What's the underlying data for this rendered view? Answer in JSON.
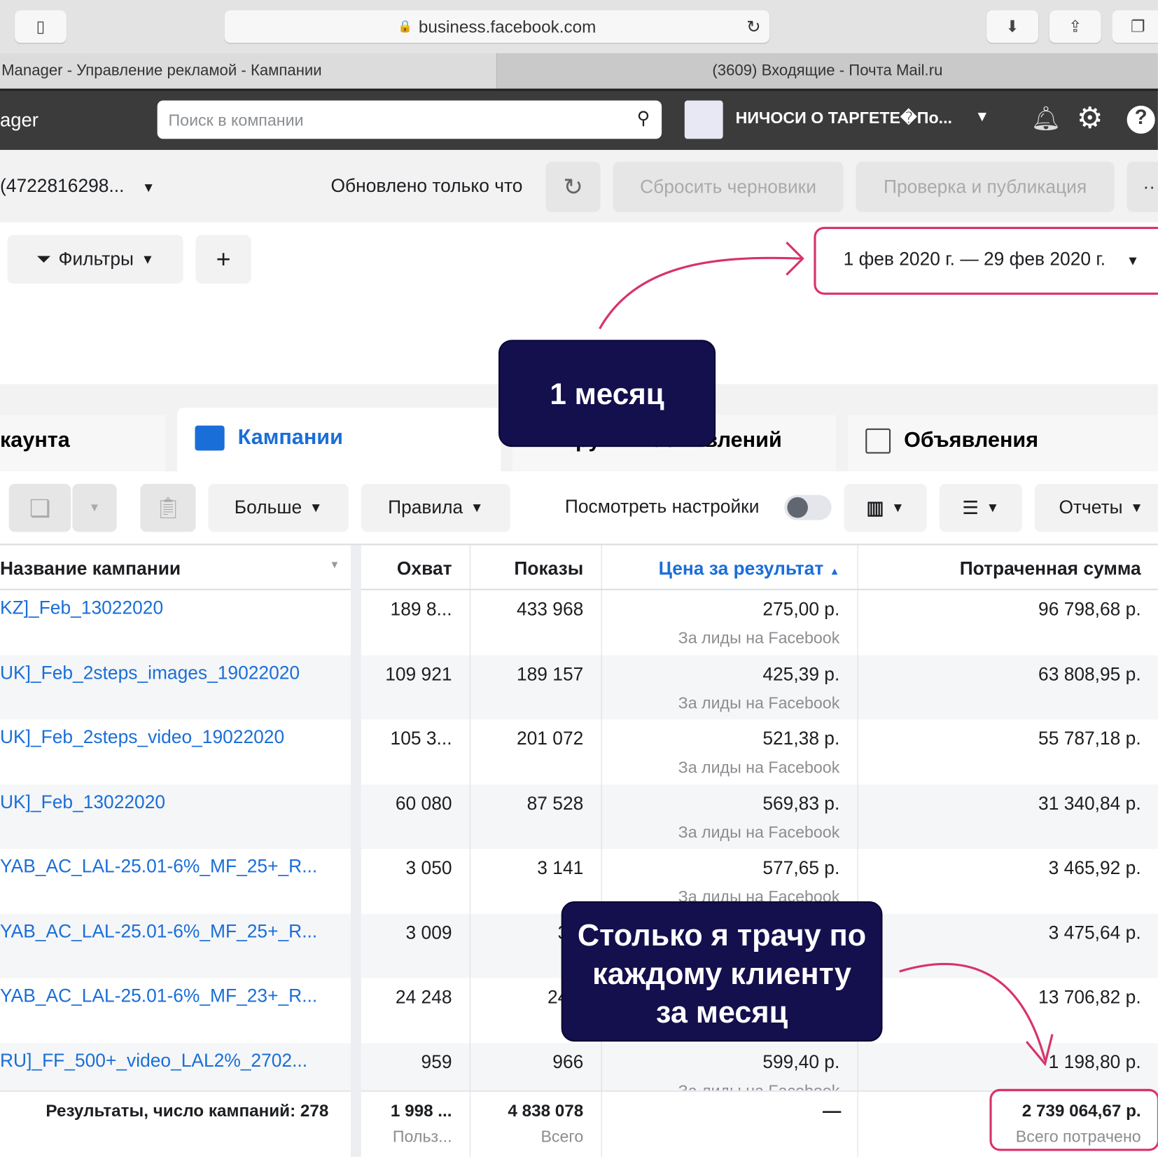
{
  "browser": {
    "url": "business.facebook.com",
    "tabs": [
      "Manager - Управление рекламой - Кампании",
      "(3609) Входящие - Почта Mail.ru"
    ]
  },
  "topbar": {
    "app_title": "ager",
    "search_placeholder": "Поиск в компании",
    "account_name": "НИЧОСИ О ТАРГЕТЕ�По..."
  },
  "toolbar": {
    "account_id": "(4722816298...",
    "updated": "Обновлено только что",
    "reset_drafts": "Сбросить черновики",
    "review_publish": "Проверка и публикация",
    "more": "··"
  },
  "filters": {
    "label": "Фильтры",
    "add": "+",
    "date_range": "1 фев 2020 г. — 29 фев 2020 г."
  },
  "level_tabs": {
    "account": "каунта",
    "campaigns": "Кампании",
    "adsets": "Группы объявлений",
    "ads": "Объявления"
  },
  "actions": {
    "more": "Больше",
    "rules": "Правила",
    "view_settings": "Посмотреть настройки",
    "reports": "Отчеты",
    "view_settings_on": false
  },
  "table": {
    "headers": {
      "name": "Название кампании",
      "reach": "Охват",
      "impressions": "Показы",
      "cost": "Цена за результат",
      "spent": "Потраченная сумма"
    },
    "rows": [
      {
        "name": "KZ]_Feb_13022020",
        "reach": "189 8...",
        "impressions": "433 968",
        "cost": "275,00 р.",
        "cost_sub": "За лиды на Facebook",
        "spent": "96 798,68 р."
      },
      {
        "name": "UK]_Feb_2steps_images_19022020",
        "reach": "109 921",
        "impressions": "189 157",
        "cost": "425,39 р.",
        "cost_sub": "За лиды на Facebook",
        "spent": "63 808,95 р."
      },
      {
        "name": "UK]_Feb_2steps_video_19022020",
        "reach": "105 3...",
        "impressions": "201 072",
        "cost": "521,38 р.",
        "cost_sub": "За лиды на Facebook",
        "spent": "55 787,18 р."
      },
      {
        "name": "UK]_Feb_13022020",
        "reach": "60 080",
        "impressions": "87 528",
        "cost": "569,83 р.",
        "cost_sub": "За лиды на Facebook",
        "spent": "31 340,84 р."
      },
      {
        "name": "YAB_AC_LAL-25.01-6%_MF_25+_R...",
        "reach": "3 050",
        "impressions": "3 141",
        "cost": "577,65 р.",
        "cost_sub": "За лиды на Facebook",
        "spent": "3 465,92 р."
      },
      {
        "name": "YAB_AC_LAL-25.01-6%_MF_25+_R...",
        "reach": "3 009",
        "impressions": "3 0",
        "cost": "",
        "cost_sub": "",
        "spent": "3 475,64 р."
      },
      {
        "name": "YAB_AC_LAL-25.01-6%_MF_23+_R...",
        "reach": "24 248",
        "impressions": "24 5",
        "cost": "",
        "cost_sub": "",
        "spent": "13 706,82 р."
      },
      {
        "name": "RU]_FF_500+_video_LAL2%_2702...",
        "reach": "959",
        "impressions": "966",
        "cost": "599,40 р.",
        "cost_sub": "За лиды на Facebook",
        "spent": "1 198,80 р."
      }
    ],
    "totals": {
      "label": "Результаты, число кампаний: 278",
      "reach": "1 998 ...",
      "reach_sub": "Польз...",
      "impressions": "4 838 078",
      "impressions_sub": "Всего",
      "cost": "—",
      "spent": "2 739 064,67 р.",
      "spent_sub": "Всего потрачено"
    }
  },
  "annotations": {
    "month": "1  месяц",
    "spend": "Столько я трачу по каждому клиенту за месяц"
  },
  "colors": {
    "link": "#1a6ed8",
    "annotation_bg": "#140f4d",
    "highlight": "#d8336a",
    "topbar": "#3b3b3b"
  }
}
